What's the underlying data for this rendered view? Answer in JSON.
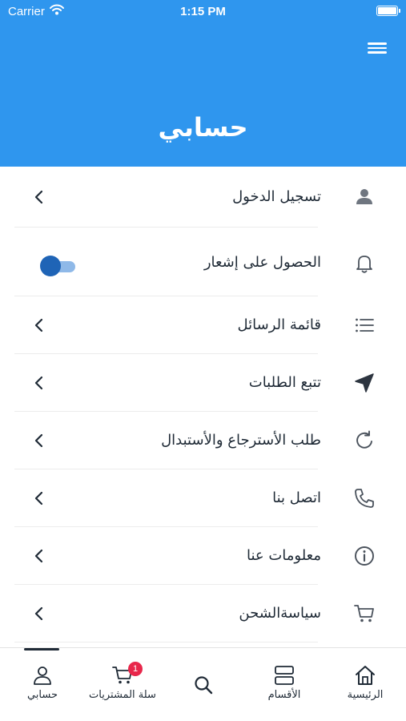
{
  "status_bar": {
    "carrier": "Carrier",
    "time": "1:15 PM"
  },
  "header": {
    "title": "حسابي",
    "menu_icon": "hamburger-icon",
    "background_color": "#2f96ee"
  },
  "menu": {
    "items": [
      {
        "label": "تسجيل الدخول",
        "icon": "user-icon"
      },
      {
        "label": "الحصول على إشعار",
        "icon": "bell-icon",
        "toggle_on": true
      },
      {
        "label": "قائمة الرسائل",
        "icon": "list-icon"
      },
      {
        "label": "تتبع الطلبات",
        "icon": "navigation-arrow-icon"
      },
      {
        "label": "طلب الأسترجاع والأستبدال",
        "icon": "refresh-icon"
      },
      {
        "label": "اتصل بنا",
        "icon": "phone-icon"
      },
      {
        "label": "معلومات عنا",
        "icon": "info-icon"
      },
      {
        "label": "سياسةالشحن",
        "icon": "cart-icon"
      }
    ]
  },
  "tabbar": {
    "tabs": [
      {
        "label": "حسابي",
        "icon": "user-icon",
        "active": true
      },
      {
        "label": "سلة المشتريات",
        "icon": "cart-icon",
        "badge": "1"
      },
      {
        "label": "",
        "icon": "search-icon"
      },
      {
        "label": "الأقسام",
        "icon": "categories-icon"
      },
      {
        "label": "الرئيسية",
        "icon": "home-icon"
      }
    ]
  }
}
